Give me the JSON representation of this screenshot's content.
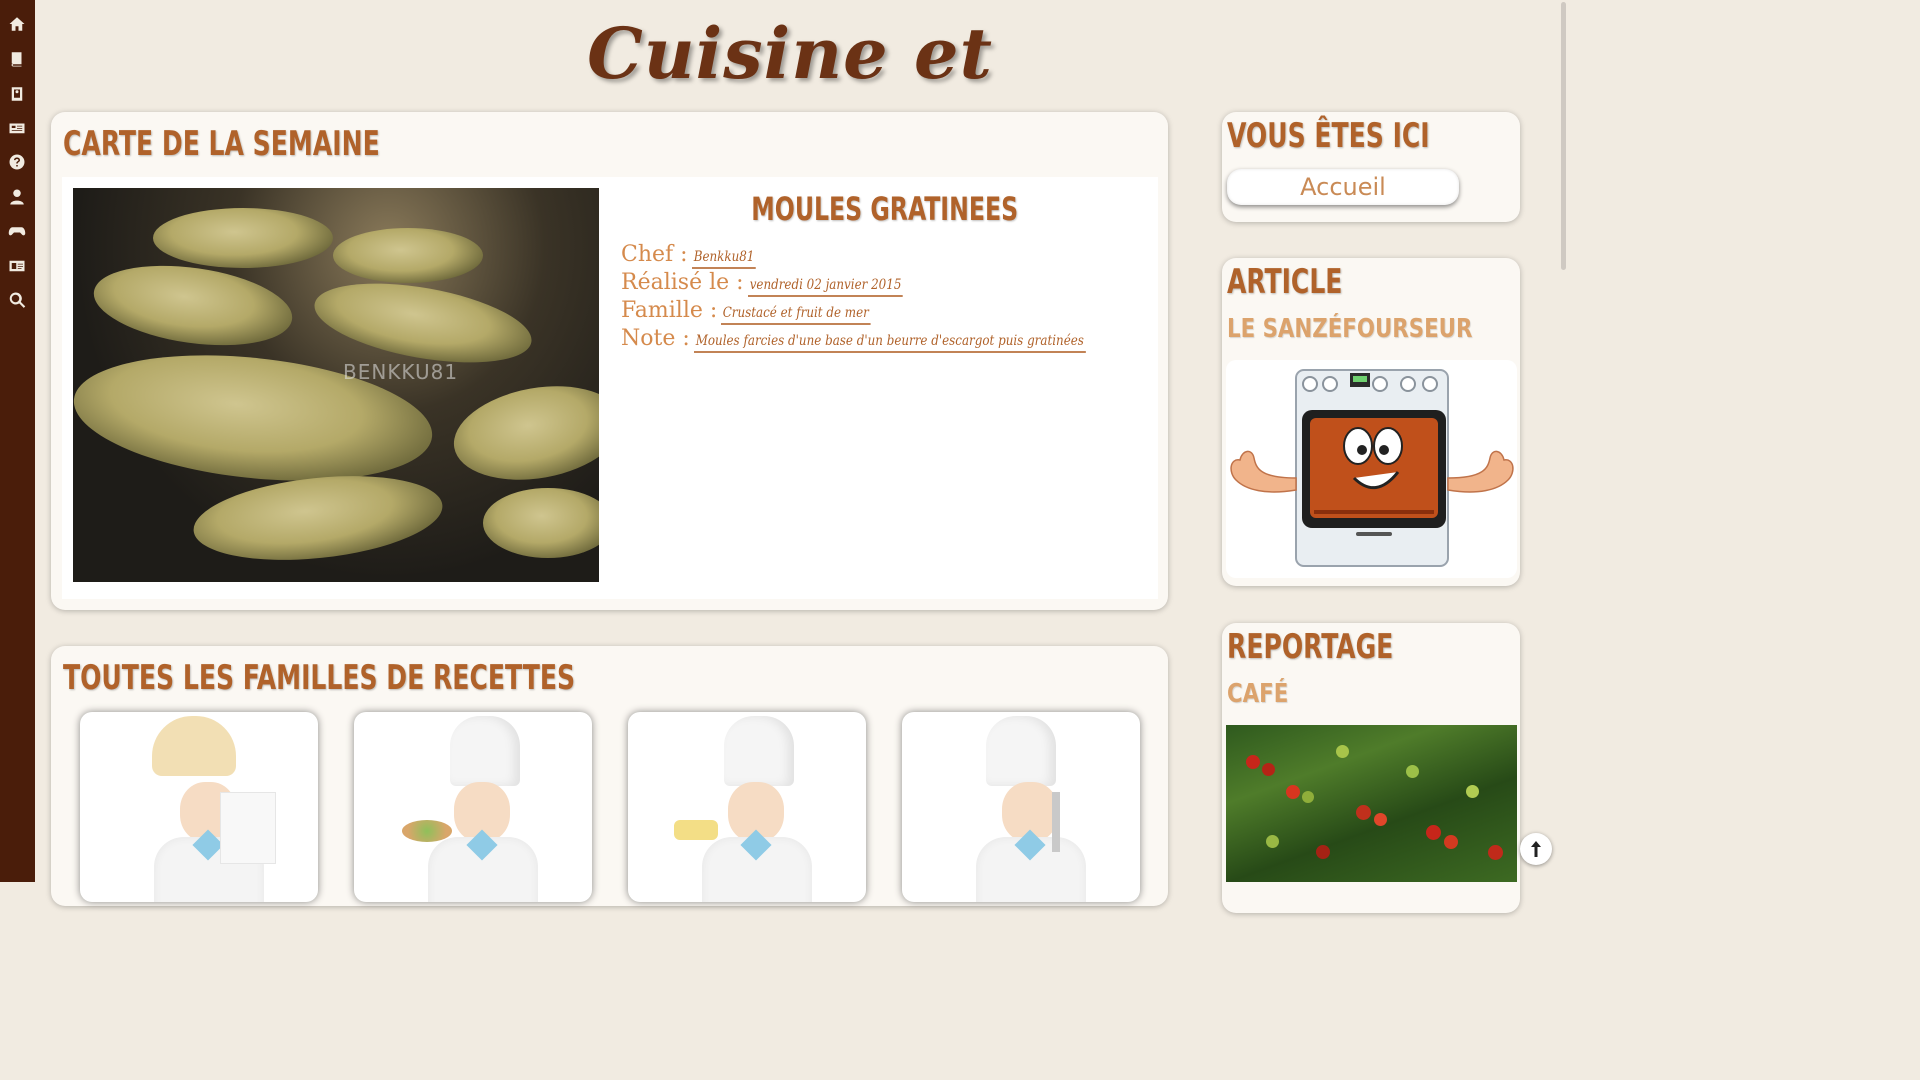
{
  "site": {
    "title": "Cuisine et Traditions"
  },
  "sidebar": {
    "icons": [
      "home-icon",
      "book-icon",
      "recipe-book-icon",
      "newspaper-icon",
      "question-icon",
      "user-icon",
      "gamepad-icon",
      "id-card-icon",
      "search-icon"
    ]
  },
  "weekly": {
    "heading": "Carte de la semaine",
    "recipe_name": "Moules Gratinees",
    "chef_label": "Chef :",
    "chef_value": "Benkku81",
    "date_label": "Réalisé le :",
    "date_value": "vendredi 02 janvier 2015",
    "family_label": "Famille :",
    "family_value": "Crustacé et fruit de mer",
    "note_label": "Note :",
    "note_value": "Moules farcies d'une base d'un beurre d'escargot puis gratinées",
    "photo_watermark": "BENKKU81"
  },
  "families": {
    "heading": "Toutes les familles de recettes",
    "cards": [
      "chef-with-paper",
      "chef-with-salad",
      "chef-with-dessert",
      "chef-with-utensil"
    ]
  },
  "location": {
    "heading": "Vous êtes ici",
    "breadcrumb": "Accueil"
  },
  "article": {
    "heading": "Article",
    "title": "Le Sanzéfourseur"
  },
  "reportage": {
    "heading": "Reportage",
    "title": "Café"
  },
  "colors": {
    "sidebar": "#4a1d0a",
    "background": "#f1ebe1",
    "heading": "#b0622a",
    "subheading": "#dca36c"
  }
}
